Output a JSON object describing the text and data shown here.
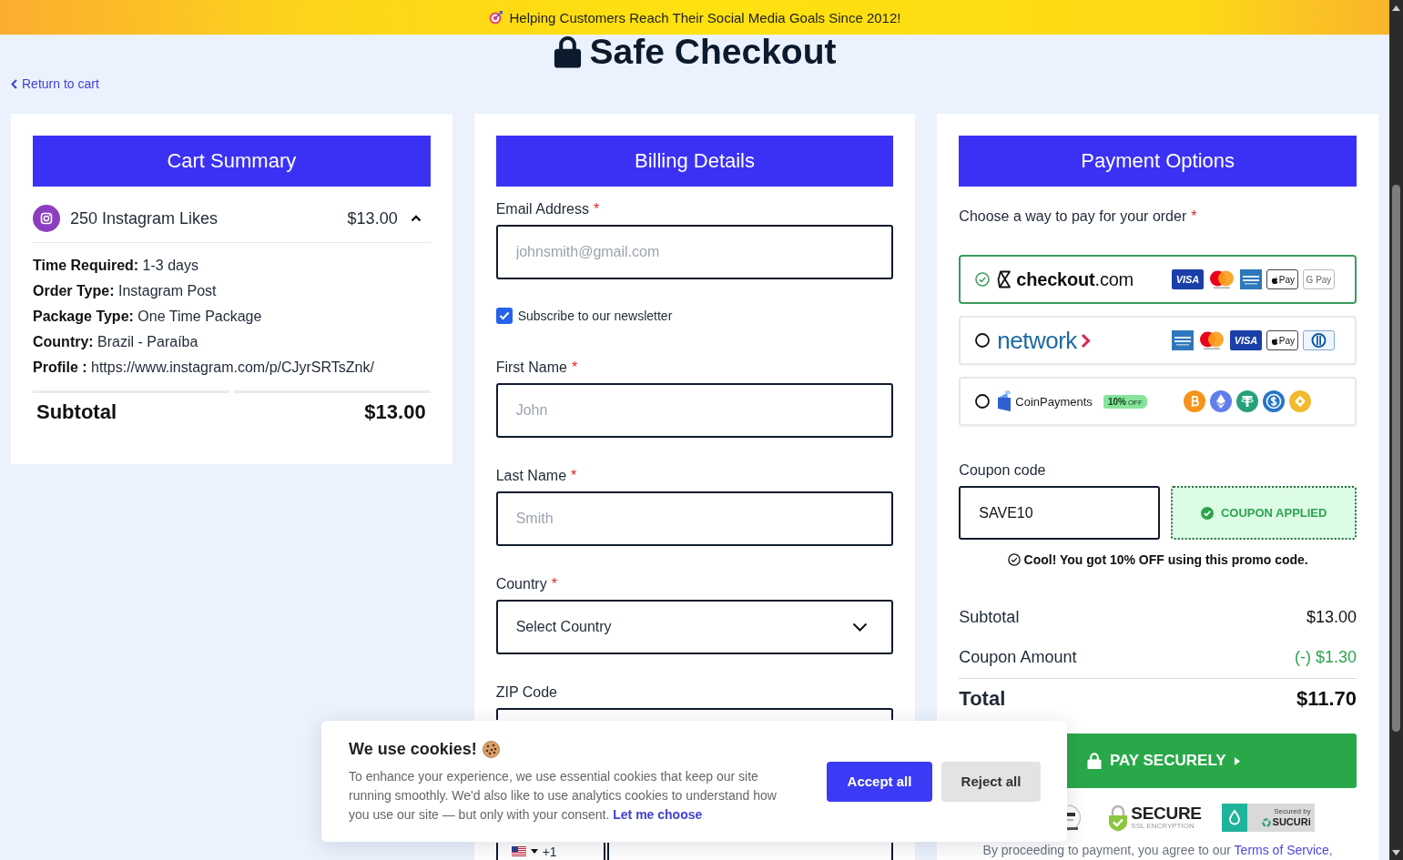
{
  "banner": {
    "text": "Helping Customers Reach Their Social Media Goals Since 2012!"
  },
  "page_title": "Safe Checkout",
  "back_link": "Return to cart",
  "cart": {
    "title": "Cart Summary",
    "items": [
      {
        "name": "250 Instagram Likes",
        "price": "$13.00",
        "expanded": true,
        "details": [
          "**Time Required:** 1-3 days",
          "**Order Type:** Instagram Post",
          "**Package Type:** One Time Package",
          "**Country:** Brazil - Paraíba",
          "**Profile :** https://www.instagram.com/p/CJyrSRTsZnk/"
        ]
      }
    ],
    "subtotal": {
      "label": "Subtotal",
      "value": "$13.00"
    }
  },
  "billing": {
    "title": "Billing Details",
    "fields": [
      {
        "kind": "input",
        "label": "Email Address",
        "required_mark": "*",
        "placeholder": "johnsmith@gmail.com"
      },
      {
        "kind": "checkbox",
        "label": "Subscribe to our newsletter",
        "checked": true
      },
      {
        "kind": "input",
        "label": "First Name",
        "required_mark": "*",
        "placeholder": "John"
      },
      {
        "kind": "input",
        "label": "Last Name",
        "required_mark": "*",
        "placeholder": "Smith"
      },
      {
        "kind": "select",
        "label": "Country",
        "required_mark": "*",
        "value": "Select Country"
      },
      {
        "kind": "input",
        "label": "ZIP Code"
      },
      {
        "kind": "phone",
        "dial_code": "+1"
      }
    ]
  },
  "payment": {
    "title": "Payment Options",
    "prompt": "Choose a way to pay for your order",
    "required_mark": "*",
    "options": [
      {
        "kind": "checkout",
        "selected": true,
        "logo": "**checkout**.com",
        "methods": [
          {
            "kind": "visa",
            "label": "VISA"
          },
          {
            "kind": "mastercard"
          },
          {
            "kind": "amex"
          },
          {
            "kind": "applepay",
            "label": "Pay"
          },
          {
            "kind": "googlepay",
            "label": "G Pay"
          }
        ]
      },
      {
        "kind": "network",
        "selected": false,
        "logo": "network",
        "methods": [
          {
            "kind": "amex"
          },
          {
            "kind": "mastercard"
          },
          {
            "kind": "visa",
            "label": "VISA"
          },
          {
            "kind": "applepay",
            "label": "Pay"
          },
          {
            "kind": "diners"
          }
        ]
      },
      {
        "kind": "coinpayments",
        "selected": false,
        "logo": "CoinPayments",
        "tag": {
          "value": "10%",
          "suffix": "OFF"
        },
        "methods": [
          {
            "kind": "bitcoin"
          },
          {
            "kind": "ethereum"
          },
          {
            "kind": "tether"
          },
          {
            "kind": "usdc"
          },
          {
            "kind": "bnb"
          }
        ]
      }
    ],
    "coupon": {
      "label": "Coupon code",
      "value": "SAVE10",
      "applied": true,
      "status": "COUPON APPLIED",
      "message": "Cool! You got 10% OFF using this promo code."
    },
    "summary": [
      {
        "kind": "amount",
        "label": "Subtotal",
        "value": "$13.00"
      },
      {
        "kind": "discount",
        "label": "Coupon Amount",
        "value": "(-) $1.30"
      },
      {
        "kind": "total",
        "label": "Total",
        "value": "$11.70"
      }
    ],
    "pay_button": "PAY SECURELY",
    "badges": [
      {
        "kind": "seal"
      },
      {
        "kind": "ssl",
        "title": "SECURE",
        "subtitle": "SSL ENCRYPTION"
      },
      {
        "kind": "sucuri",
        "caption": "Secured by",
        "title": "SUCURi"
      }
    ],
    "terms": {
      "text": "By proceeding to payment, you agree to our ",
      "link": "Terms of Service",
      "after": ","
    }
  },
  "cookie_notice": {
    "title": "We use cookies!",
    "text": "To enhance your experience, we use essential cookies that keep our site running smoothly. We'd also like to use analytics cookies to understand how you use our site — but only with your consent.",
    "link": "Let me choose",
    "buttons": [
      {
        "kind": "primary",
        "label": "Accept all"
      },
      {
        "kind": "secondary",
        "label": "Reject all"
      }
    ]
  }
}
